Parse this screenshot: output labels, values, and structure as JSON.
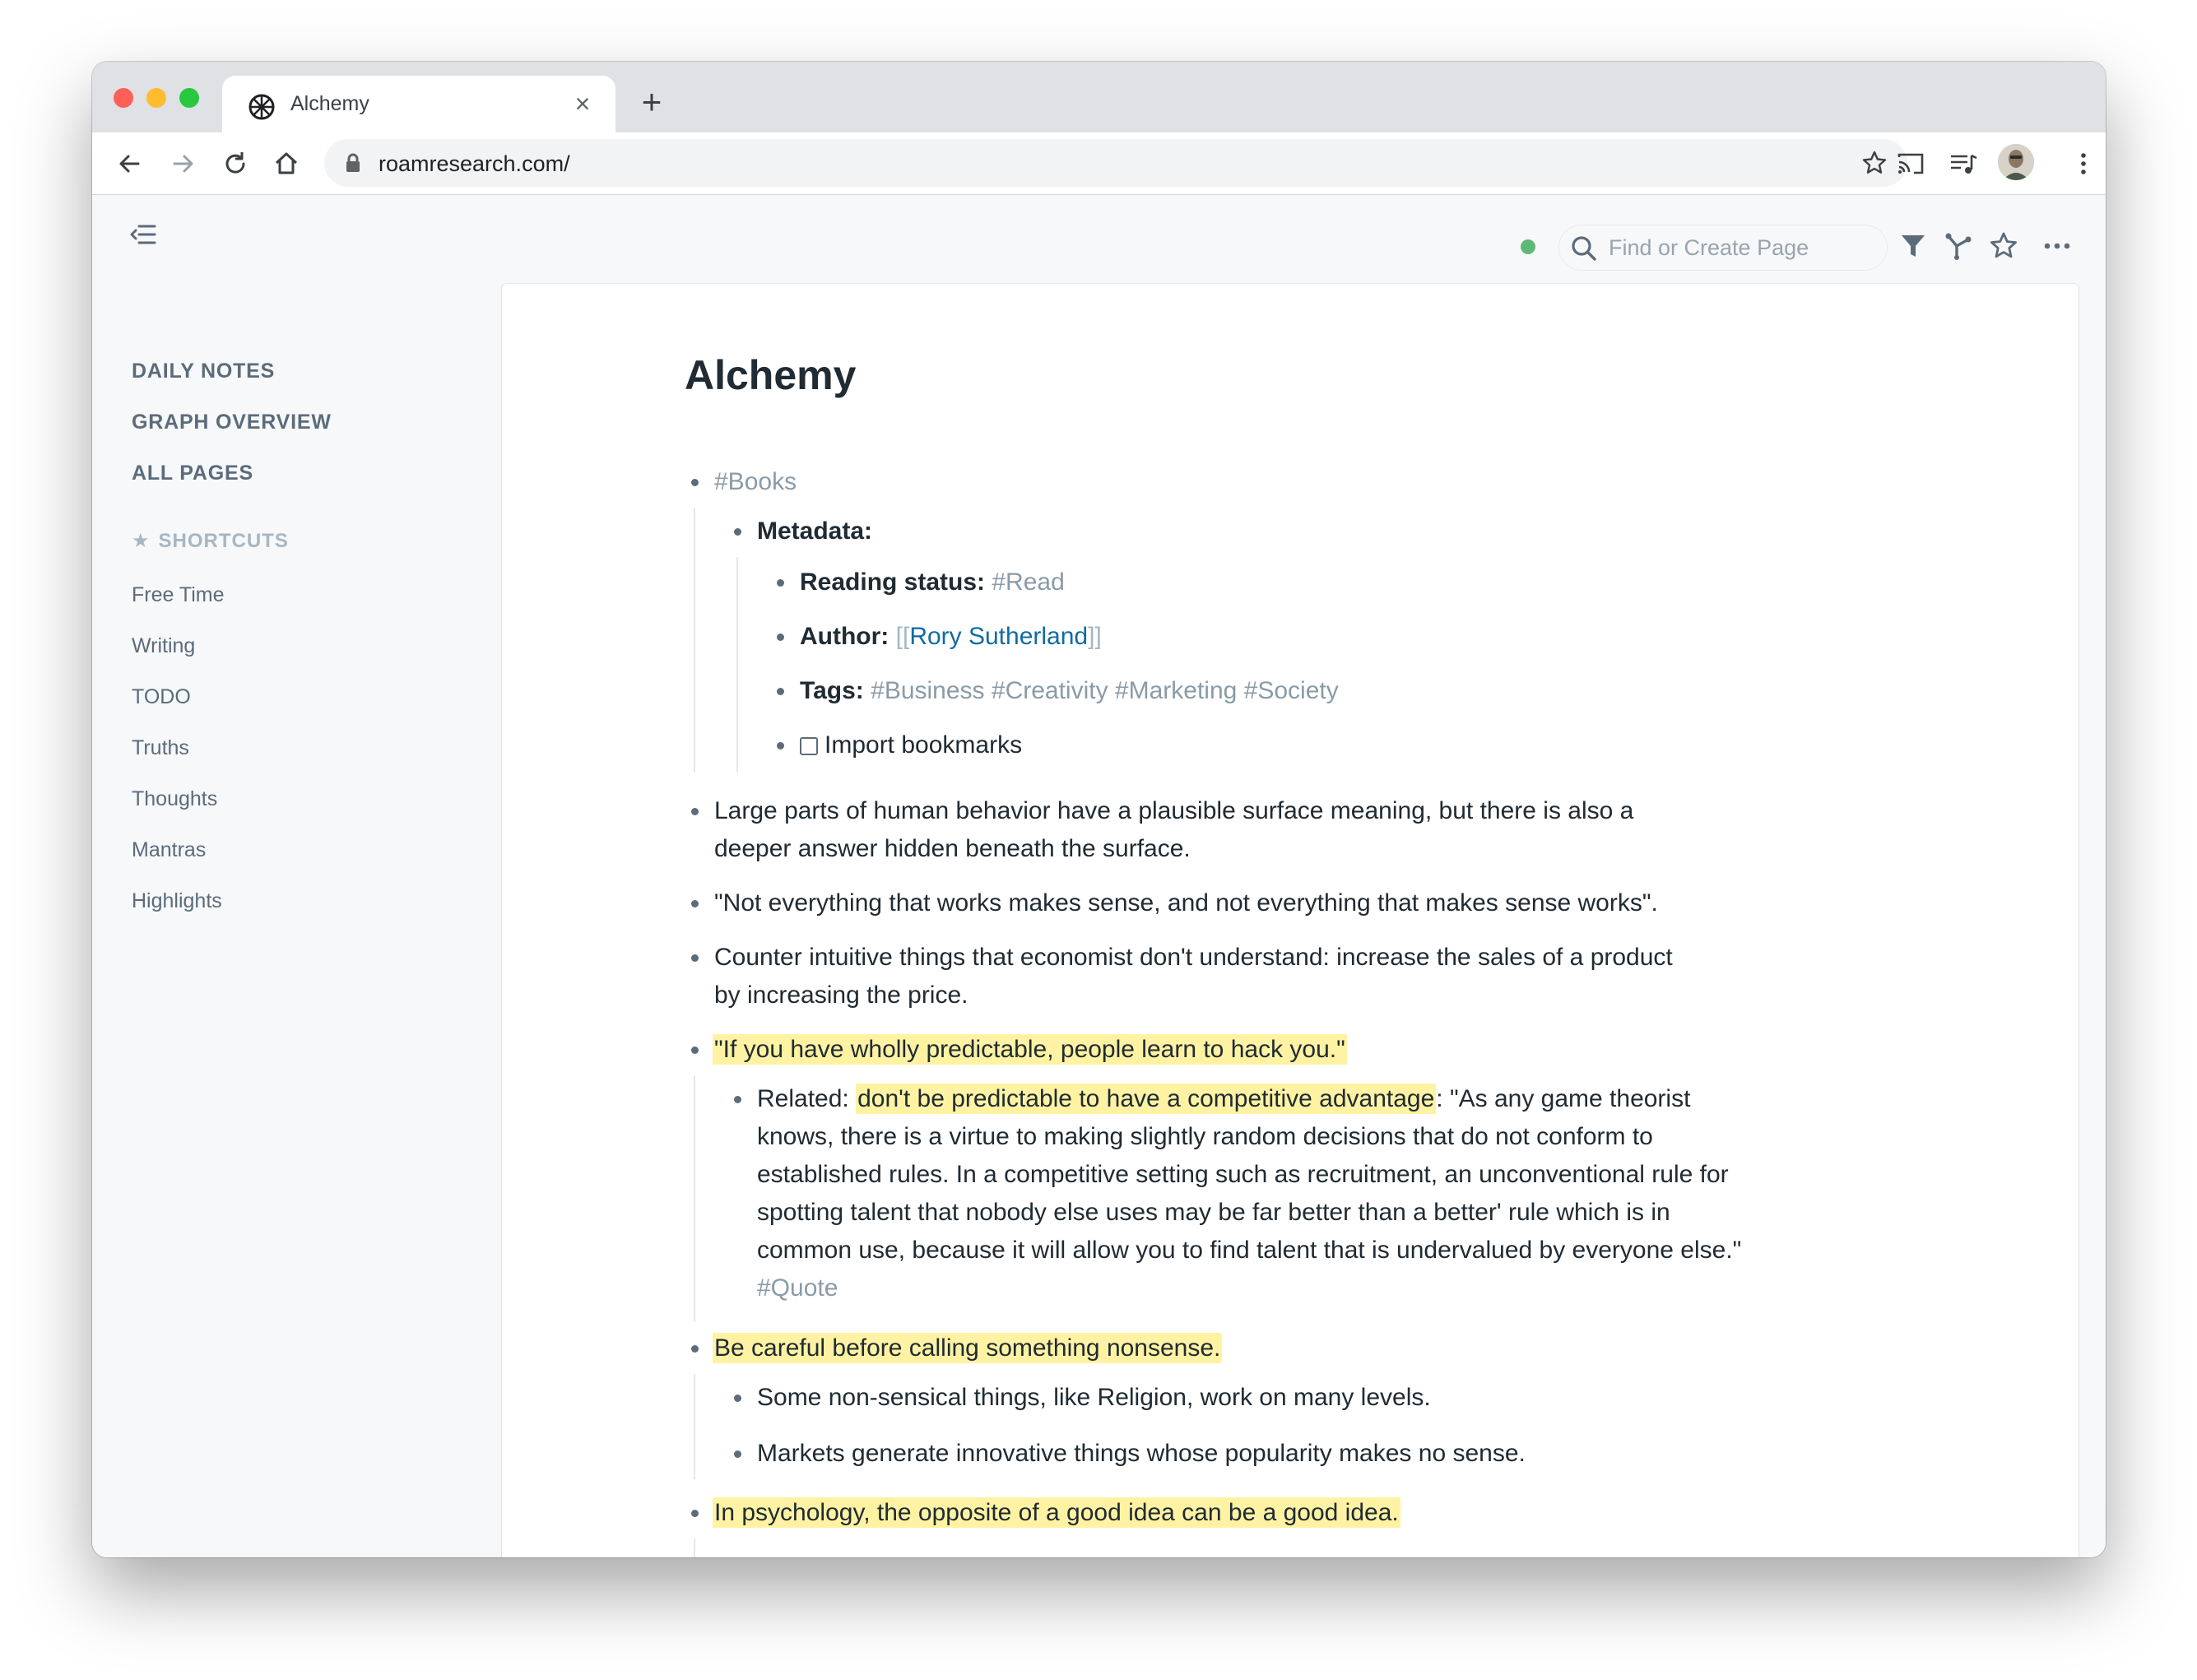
{
  "browser": {
    "tab_title": "Alchemy",
    "url": "roamresearch.com/"
  },
  "sidebar": {
    "nav": [
      "DAILY NOTES",
      "GRAPH OVERVIEW",
      "ALL PAGES"
    ],
    "shortcuts_header": "SHORTCUTS",
    "shortcuts": [
      "Free Time",
      "Writing",
      "TODO",
      "Truths",
      "Thoughts",
      "Mantras",
      "Highlights"
    ]
  },
  "topbar": {
    "search_placeholder": "Find or Create Page",
    "sync_color": "#5fb878"
  },
  "page": {
    "title": "Alchemy",
    "books_tag": "#Books",
    "metadata_label": "Metadata:",
    "reading_label": "Reading status:",
    "reading_value": "#Read",
    "author_label": "Author:",
    "author_open": "[[",
    "author_name": "Rory Sutherland",
    "author_close": "]]",
    "tags_label": "Tags:",
    "tags": "#Business #Creativity #Marketing #Society",
    "todo_text": "Import bookmarks",
    "b1_l1": "Large parts of human behavior have a plausible surface meaning, but there is also a",
    "b1_l2": "deeper answer hidden beneath the surface.",
    "b2": "\"Not everything that works makes sense, and not everything that makes sense works\".",
    "b3_l1": "Counter intuitive things that economist don't understand: increase the sales of a product",
    "b3_l2": "by increasing the price.",
    "b4": "\"If you have wholly predictable, people learn to hack you.\"",
    "b4c_prefix": "Related: ",
    "b4c_highlight": "don't be predictable to have a competitive advantage",
    "b4c_l1_rest": ": \"As any game theorist",
    "b4c_l2": "knows, there is a virtue to making slightly random decisions that do not conform to",
    "b4c_l3": "established rules. In a competitive setting such as recruitment, an unconventional rule for",
    "b4c_l4": "spotting talent that nobody else uses may be far better than a better' rule which is in",
    "b4c_l5": "common use, because it will allow you to find talent that is undervalued by everyone else.\"",
    "b4c_tag": "#Quote",
    "b5": "Be careful before calling something nonsense.",
    "b5c1": "Some non-sensical things, like Religion, work on many levels.",
    "b5c2": "Markets generate innovative things whose popularity makes no sense.",
    "b6": "In psychology, the opposite of a good idea can be a good idea."
  },
  "colors": {
    "highlight": "#fff3a3",
    "tag": "#8a9ba8",
    "link": "#106ba3"
  }
}
